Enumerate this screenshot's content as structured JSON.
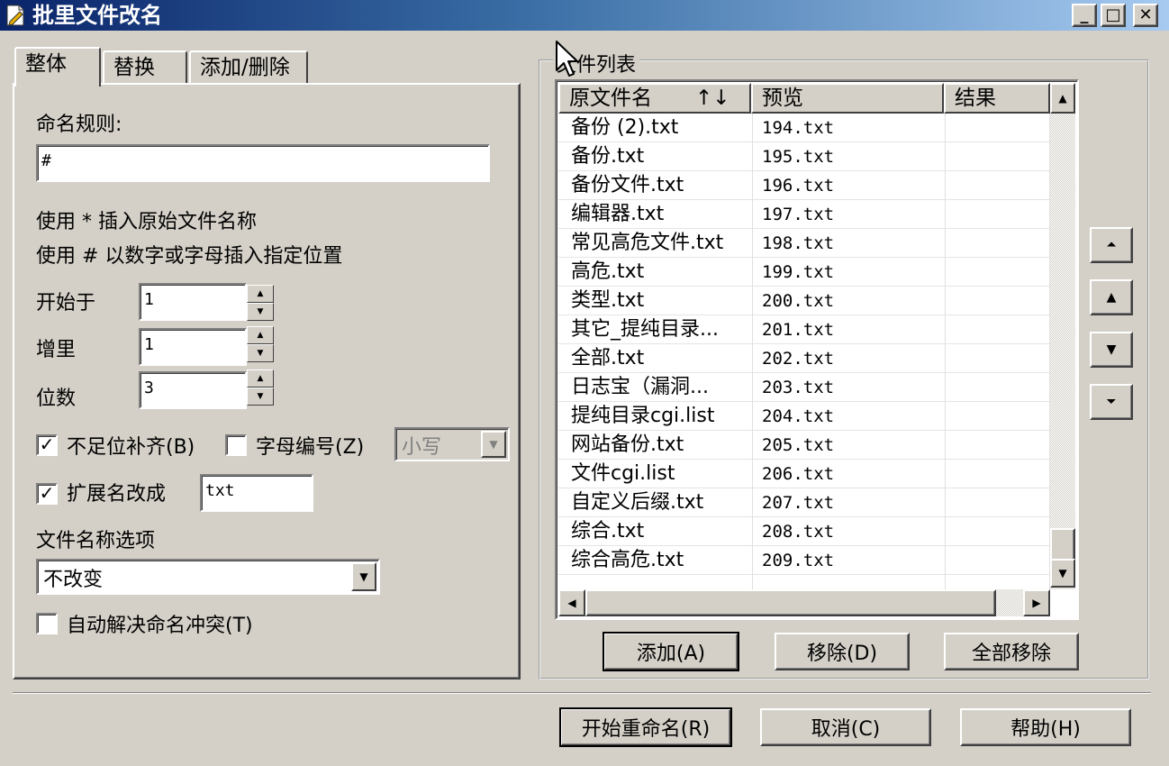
{
  "window": {
    "title": "批里文件改名",
    "icon": "document-pencil-icon",
    "controls": {
      "minimize": "_",
      "maximize": "□",
      "close": "✕"
    }
  },
  "tabs": [
    {
      "label": "整体",
      "active": true
    },
    {
      "label": "替换",
      "active": false
    },
    {
      "label": "添加/删除",
      "active": false
    }
  ],
  "general": {
    "rule_label": "命名规则:",
    "rule_value": "#",
    "hint1": "使用 * 插入原始文件名称",
    "hint2": "使用 # 以数字或字母插入指定位置",
    "start_label": "开始于",
    "start_value": "1",
    "increment_label": "增里",
    "increment_value": "1",
    "digits_label": "位数",
    "digits_value": "3",
    "pad_label": "不足位补齐(B)",
    "pad_checked": true,
    "letter_label": "字母编号(Z)",
    "letter_checked": false,
    "case_value": "小写",
    "ext_label": "扩展名改成",
    "ext_checked": true,
    "ext_value": "txt",
    "name_option_label": "文件名称选项",
    "name_option_value": "不改变",
    "auto_resolve_label": "自动解决命名冲突(T)",
    "auto_resolve_checked": false
  },
  "file_list": {
    "group_label": "文件列表",
    "columns": {
      "original": "原文件名",
      "sort_arrows": "↑↓",
      "preview": "预览",
      "result": "结果"
    },
    "rows": [
      {
        "original": "备份 (2).txt",
        "preview": "194.txt",
        "result": ""
      },
      {
        "original": "备份.txt",
        "preview": "195.txt",
        "result": ""
      },
      {
        "original": "备份文件.txt",
        "preview": "196.txt",
        "result": ""
      },
      {
        "original": "编辑器.txt",
        "preview": "197.txt",
        "result": ""
      },
      {
        "original": "常见高危文件.txt",
        "preview": "198.txt",
        "result": ""
      },
      {
        "original": "高危.txt",
        "preview": "199.txt",
        "result": ""
      },
      {
        "original": "类型.txt",
        "preview": "200.txt",
        "result": ""
      },
      {
        "original": "其它_提纯目录...",
        "preview": "201.txt",
        "result": ""
      },
      {
        "original": "全部.txt",
        "preview": "202.txt",
        "result": ""
      },
      {
        "original": "日志宝（漏洞...",
        "preview": "203.txt",
        "result": ""
      },
      {
        "original": "提纯目录cgi.list",
        "preview": "204.txt",
        "result": ""
      },
      {
        "original": "网站备份.txt",
        "preview": "205.txt",
        "result": ""
      },
      {
        "original": "文件cgi.list",
        "preview": "206.txt",
        "result": ""
      },
      {
        "original": "自定义后缀.txt",
        "preview": "207.txt",
        "result": ""
      },
      {
        "original": "综合.txt",
        "preview": "208.txt",
        "result": ""
      },
      {
        "original": "综合高危.txt",
        "preview": "209.txt",
        "result": ""
      }
    ],
    "add_button": "添加(A)",
    "remove_button": "移除(D)",
    "remove_all_button": "全部移除"
  },
  "footer": {
    "start_button": "开始重命名(R)",
    "cancel_button": "取消(C)",
    "help_button": "帮助(H)"
  }
}
